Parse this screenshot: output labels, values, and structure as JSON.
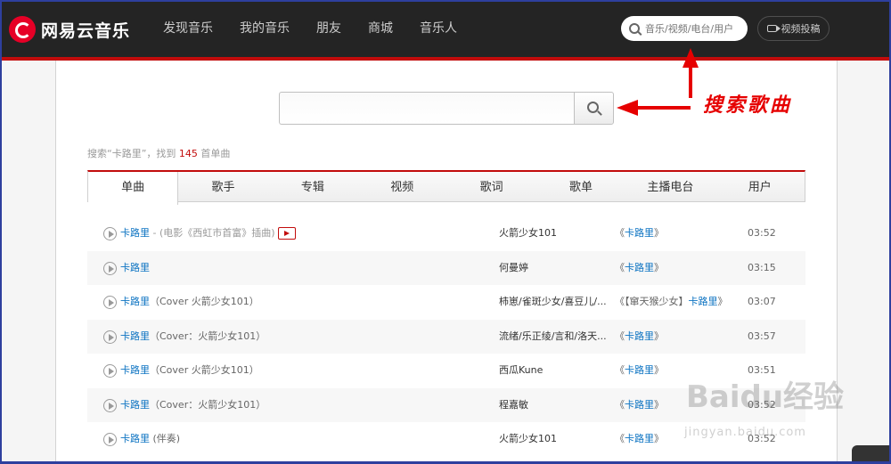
{
  "brand": {
    "logo_text": "网易云音乐"
  },
  "nav": {
    "items": [
      {
        "label": "发现音乐"
      },
      {
        "label": "我的音乐"
      },
      {
        "label": "朋友"
      },
      {
        "label": "商城"
      },
      {
        "label": "音乐人"
      }
    ]
  },
  "top_search": {
    "placeholder": "音乐/视频/电台/用户"
  },
  "upload_button": {
    "label": "视频投稿"
  },
  "main_search": {
    "value": ""
  },
  "result_summary": {
    "prefix": "搜索“卡路里”，找到 ",
    "count": "145",
    "suffix": " 首单曲"
  },
  "tabs": [
    {
      "label": "单曲",
      "active": true
    },
    {
      "label": "歌手"
    },
    {
      "label": "专辑"
    },
    {
      "label": "视频"
    },
    {
      "label": "歌词"
    },
    {
      "label": "歌单"
    },
    {
      "label": "主播电台"
    },
    {
      "label": "用户"
    }
  ],
  "songs": [
    {
      "name": "卡路里",
      "extra": " - (电影《西虹市首富》插曲)",
      "artist": "火箭少女101",
      "album_prefix": "《",
      "album": "卡路里",
      "album_suffix": "》",
      "duration": "03:52",
      "has_mv": true
    },
    {
      "name": "卡路里",
      "extra": "",
      "artist": "何曼婷",
      "album_prefix": "《",
      "album": "卡路里",
      "album_suffix": "》",
      "duration": "03:15"
    },
    {
      "name": "卡路里",
      "extra": "（Cover 火箭少女101）",
      "artist": "柿崽/雀斑少女/喜豆儿/...",
      "album_prefix": "《【窜天猴少女】",
      "album": "卡路里",
      "album_suffix": "》",
      "duration": "03:07"
    },
    {
      "name": "卡路里",
      "extra": "（Cover：火箭少女101）",
      "artist": "流绪/乐正绫/言和/洛天...",
      "album_prefix": "《",
      "album": "卡路里",
      "album_suffix": "》",
      "duration": "03:57"
    },
    {
      "name": "卡路里",
      "extra": "（Cover 火箭少女101）",
      "artist": "西瓜Kune",
      "album_prefix": "《",
      "album": "卡路里",
      "album_suffix": "》",
      "duration": "03:51"
    },
    {
      "name": "卡路里",
      "extra": "（Cover：火箭少女101）",
      "artist": "程嘉敏",
      "album_prefix": "《",
      "album": "卡路里",
      "album_suffix": "》",
      "duration": "03:52"
    },
    {
      "name": "卡路里",
      "extra": " (伴奏)",
      "artist": "火箭少女101",
      "album_prefix": "《",
      "album": "卡路里",
      "album_suffix": "》",
      "duration": "03:52"
    }
  ],
  "annotation": {
    "label": "搜索歌曲",
    "color": "#e60000"
  },
  "watermark": {
    "text": "Baidu经验",
    "url": "jingyan.baidu.com"
  },
  "colors": {
    "nav_bg": "#242424",
    "brand_red": "#c20c0c",
    "link_blue": "#0c73c2"
  }
}
